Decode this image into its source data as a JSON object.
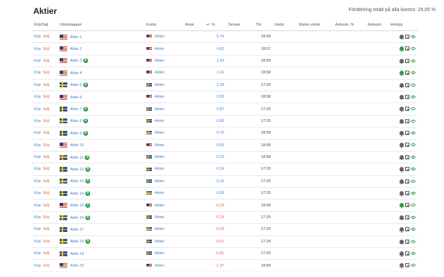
{
  "header": {
    "title": "Aktier",
    "summary": "Fördelning totalt på alla konton: 28,55 %"
  },
  "table": {
    "columns": {
      "trade": "Köp/Sälj",
      "security": "Värdepapper",
      "account": "Konto",
      "quantity": "Antal",
      "change": "+/- %",
      "last": "Senast",
      "time": "Tid",
      "purchase": "Inköp",
      "market_value": "Markn.värde",
      "return_pct": "Avkastn. %",
      "return": "Avkastn.",
      "tools": "Verktyg"
    },
    "buy_label": "Köp",
    "sell_label": "Sälj",
    "rows": [
      {
        "name": "Aktie 1",
        "flag": "us",
        "dividend": false,
        "account": "Aktier",
        "change": "5,74",
        "dir": "pos",
        "time": "18:58",
        "alert": "off"
      },
      {
        "name": "Aktie 2",
        "flag": "us",
        "dividend": false,
        "account": "Aktier",
        "change": "4,81",
        "dir": "pos",
        "time": "18:57",
        "alert": "on"
      },
      {
        "name": "Aktie 3",
        "flag": "us",
        "dividend": true,
        "account": "Aktier",
        "change": "1,99",
        "dir": "pos",
        "time": "18:58",
        "alert": "off"
      },
      {
        "name": "Aktie 4",
        "flag": "us",
        "dividend": false,
        "account": "Aktier",
        "change": "1,41",
        "dir": "pos",
        "time": "18:58",
        "alert": "on"
      },
      {
        "name": "Aktie 5",
        "flag": "se",
        "dividend": true,
        "account": "Aktier",
        "change": "1,18",
        "dir": "pos",
        "time": "17:29",
        "alert": "off"
      },
      {
        "name": "Aktie 6",
        "flag": "us",
        "dividend": false,
        "account": "Aktier",
        "change": "0,93",
        "dir": "pos",
        "time": "18:58",
        "alert": "off"
      },
      {
        "name": "Aktie 7",
        "flag": "se",
        "dividend": true,
        "account": "Aktier",
        "change": "0,87",
        "dir": "pos",
        "time": "17:29",
        "alert": "off"
      },
      {
        "name": "Aktie 8",
        "flag": "se",
        "dividend": true,
        "account": "Aktier",
        "change": "0,80",
        "dir": "pos",
        "time": "17:29",
        "alert": "off"
      },
      {
        "name": "Aktie 9",
        "flag": "se",
        "dividend": true,
        "account": "Aktier",
        "change": "0,70",
        "dir": "pos",
        "time": "18:58",
        "alert": "off"
      },
      {
        "name": "Aktie 10",
        "flag": "us",
        "dividend": false,
        "account": "Aktier",
        "change": "0,63",
        "dir": "pos",
        "time": "18:58",
        "alert": "off"
      },
      {
        "name": "Aktie 11",
        "flag": "se",
        "dividend": true,
        "account": "Aktier",
        "change": "0,29",
        "dir": "pos",
        "time": "18:58",
        "alert": "off"
      },
      {
        "name": "Aktie 12",
        "flag": "se",
        "dividend": true,
        "account": "Aktier",
        "change": "0,19",
        "dir": "pos",
        "time": "17:29",
        "alert": "off"
      },
      {
        "name": "Aktie 13",
        "flag": "se",
        "dividend": true,
        "account": "Aktier",
        "change": "0,16",
        "dir": "pos",
        "time": "17:29",
        "alert": "off"
      },
      {
        "name": "Aktie 14",
        "flag": "se",
        "dividend": true,
        "account": "Aktier",
        "change": "0,08",
        "dir": "pos",
        "time": "17:29",
        "alert": "off"
      },
      {
        "name": "Aktie 15",
        "flag": "us",
        "dividend": true,
        "account": "Aktier",
        "change": "-0,19",
        "dir": "neg",
        "time": "18:58",
        "alert": "on"
      },
      {
        "name": "Aktie 16",
        "flag": "se",
        "dividend": true,
        "account": "Aktier",
        "change": "-0,20",
        "dir": "neg",
        "time": "17:29",
        "alert": "off"
      },
      {
        "name": "Aktie 17",
        "flag": "se",
        "dividend": false,
        "account": "Aktier",
        "change": "-0,29",
        "dir": "neg",
        "time": "17:29",
        "alert": "off"
      },
      {
        "name": "Aktie 18",
        "flag": "se",
        "dividend": true,
        "account": "Aktier",
        "change": "-0,61",
        "dir": "neg",
        "time": "17:29",
        "alert": "off"
      },
      {
        "name": "Aktie 19",
        "flag": "se",
        "dividend": false,
        "account": "Aktier",
        "change": "-0,81",
        "dir": "neg",
        "time": "17:29",
        "alert": "off"
      },
      {
        "name": "Aktie 20",
        "flag": "us",
        "dividend": false,
        "account": "Aktier",
        "change": "-1,37",
        "dir": "neg",
        "time": "18:58",
        "alert": "off"
      }
    ]
  },
  "colors": {
    "positive": "#3b7dd8",
    "negative": "#e05a5a",
    "accent_green": "#2e9e4a"
  },
  "icons": {
    "dividend": "S",
    "tools": [
      "bell-icon",
      "notes-icon",
      "eye-icon"
    ]
  }
}
